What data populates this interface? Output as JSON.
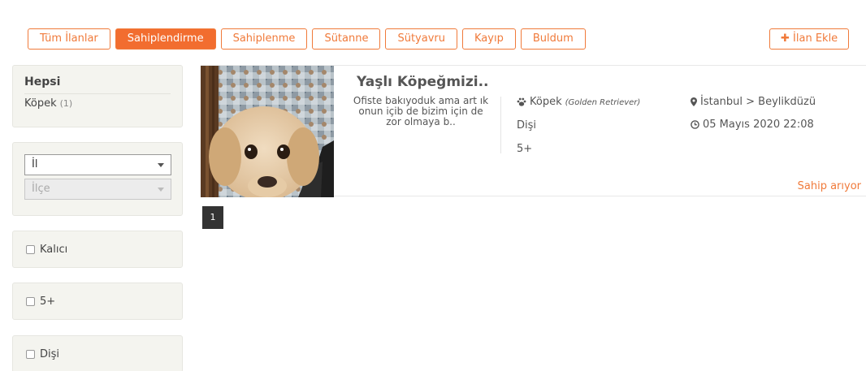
{
  "filters": {
    "tabs": [
      {
        "label": "Tüm İlanlar",
        "active": false
      },
      {
        "label": "Sahiplendirme",
        "active": true
      },
      {
        "label": "Sahiplenme",
        "active": false
      },
      {
        "label": "Sütanne",
        "active": false
      },
      {
        "label": "Sütyavru",
        "active": false
      },
      {
        "label": "Kayıp",
        "active": false
      },
      {
        "label": "Buldum",
        "active": false
      }
    ],
    "add_label": "İlan Ekle"
  },
  "sidebar": {
    "category": {
      "heading": "Hepsi",
      "items": [
        {
          "label": "Köpek",
          "count": "(1)"
        }
      ]
    },
    "location": {
      "city_value": "İl",
      "district_value": "İlçe"
    },
    "checkboxes": [
      {
        "label": "Kalıcı",
        "checked": false
      },
      {
        "label": "5+",
        "checked": false
      },
      {
        "label": "Dişi",
        "checked": false
      }
    ]
  },
  "listing": {
    "title": "Yaşlı Köpeğmizi..",
    "description": "Ofiste bakıyoduk ama art ık onun içib de bizim için de zor olmaya b..",
    "species": "Köpek",
    "breed": "(Golden Retriever)",
    "gender": "Dişi",
    "age": "5+",
    "location": "İstanbul > Beylikdüzü",
    "date": "05 Mayıs 2020 22:08",
    "status": "Sahip arıyor"
  },
  "pagination": {
    "current": "1"
  },
  "colors": {
    "accent": "#f26d2f",
    "panel_bg": "#f4f4ef",
    "pager_bg": "#333333"
  },
  "icons": {
    "add": "plus-icon",
    "species": "paw-icon",
    "location": "map-marker-icon",
    "date": "clock-icon"
  }
}
